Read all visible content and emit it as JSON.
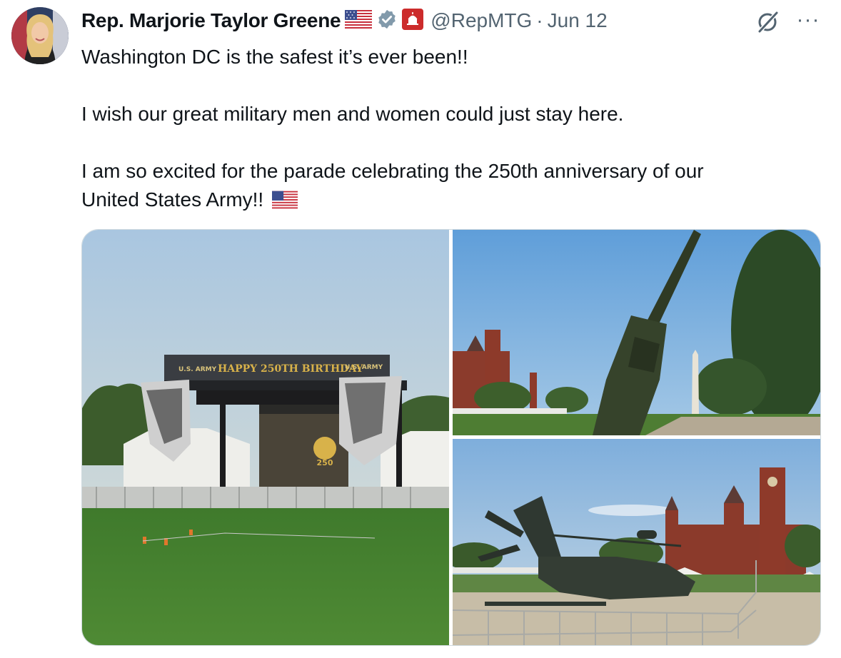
{
  "author": {
    "display_name": "Rep. Marjorie Taylor Greene",
    "handle": "@RepMTG",
    "separator": "·",
    "date": "Jun 12",
    "verified_icon": "verified-badge-icon",
    "affiliation_icon": "capitol-badge-icon",
    "flag_icon": "us-flag-emoji"
  },
  "actions": {
    "grok_icon": "grok-icon",
    "more_label": "···"
  },
  "tweet": {
    "line1": "Washington DC is the safest it’s ever been!!",
    "line2": "I wish our great military men and women could just stay here.",
    "line3a": "I am so excited for the parade celebrating the 250th anniversary of our",
    "line3b": "United States Army!!"
  },
  "media": {
    "stage_banner": "HAPPY 250TH BIRTHDAY",
    "banner_left": "U.S. ARMY",
    "banner_right": "U.S. ARMY",
    "screen_number": "250"
  },
  "colors": {
    "text": "#0f1419",
    "secondary": "#536471",
    "verified": "#829aab",
    "border": "#cfd9de"
  }
}
